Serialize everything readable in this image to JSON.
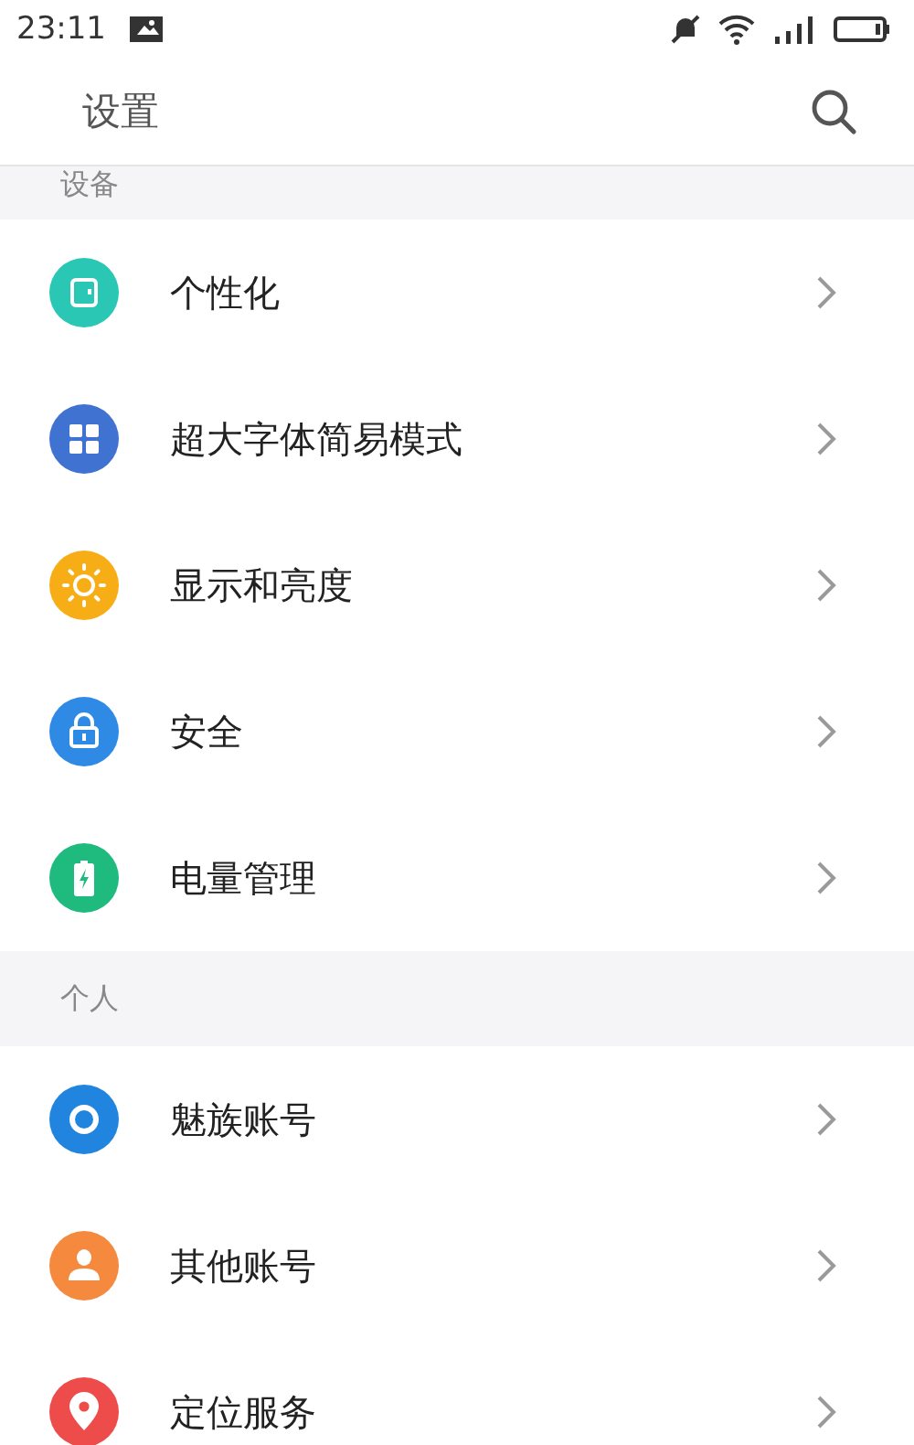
{
  "status_bar": {
    "time": "23:11"
  },
  "title_bar": {
    "title": "设置"
  },
  "sections": [
    {
      "header": "设备",
      "items": [
        {
          "label": "个性化",
          "kind": "theme",
          "color": "#2bc7b5"
        },
        {
          "label": "超大字体简易模式",
          "kind": "grid",
          "color": "#3f72d1"
        },
        {
          "label": "显示和亮度",
          "kind": "sun",
          "color": "#f7ae16"
        },
        {
          "label": "安全",
          "kind": "lock",
          "color": "#2f8ae6"
        },
        {
          "label": "电量管理",
          "kind": "battery",
          "color": "#1fba7d"
        }
      ]
    },
    {
      "header": "个人",
      "items": [
        {
          "label": "魅族账号",
          "kind": "account",
          "color": "#2185e0"
        },
        {
          "label": "其他账号",
          "kind": "person",
          "color": "#f58a3f"
        },
        {
          "label": "定位服务",
          "kind": "location",
          "color": "#ee4b4b"
        }
      ]
    }
  ]
}
